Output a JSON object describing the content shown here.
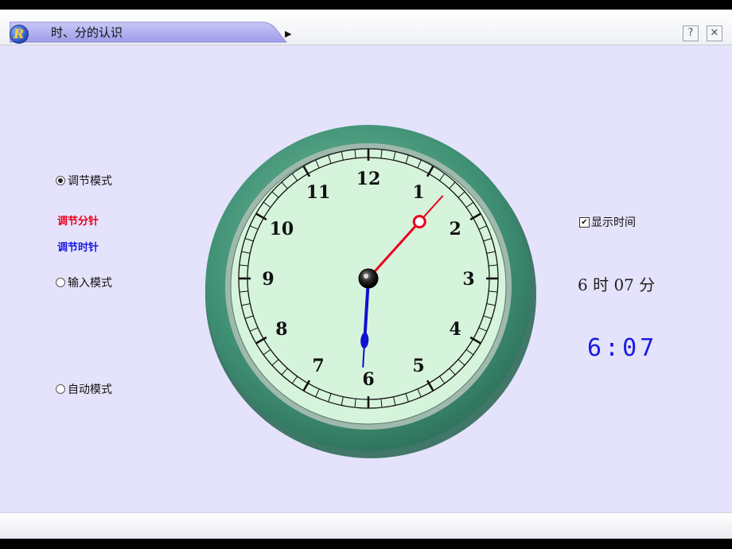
{
  "window": {
    "title": "时、分的认识",
    "logo_letter": "R",
    "help_label": "?",
    "close_label": "✕",
    "tab_arrow": "▶"
  },
  "modes": {
    "adjust": "调节模式",
    "adjust_minute": "调节分针",
    "adjust_hour": "调节时针",
    "input": "输入模式",
    "auto": "自动模式"
  },
  "display": {
    "show_time_label": "显示时间",
    "show_time_checked": true,
    "time_text": "6 时 07 分",
    "digital": "6:07"
  },
  "clock": {
    "hour": 6,
    "minute": 7,
    "numerals": [
      "12",
      "1",
      "2",
      "3",
      "4",
      "5",
      "6",
      "7",
      "8",
      "9",
      "10",
      "11"
    ],
    "minute_hand_color": "#e8001e",
    "hour_hand_color": "#1010d0",
    "frame_color": "#3f8f74",
    "face_color": "#d6f3dc"
  }
}
